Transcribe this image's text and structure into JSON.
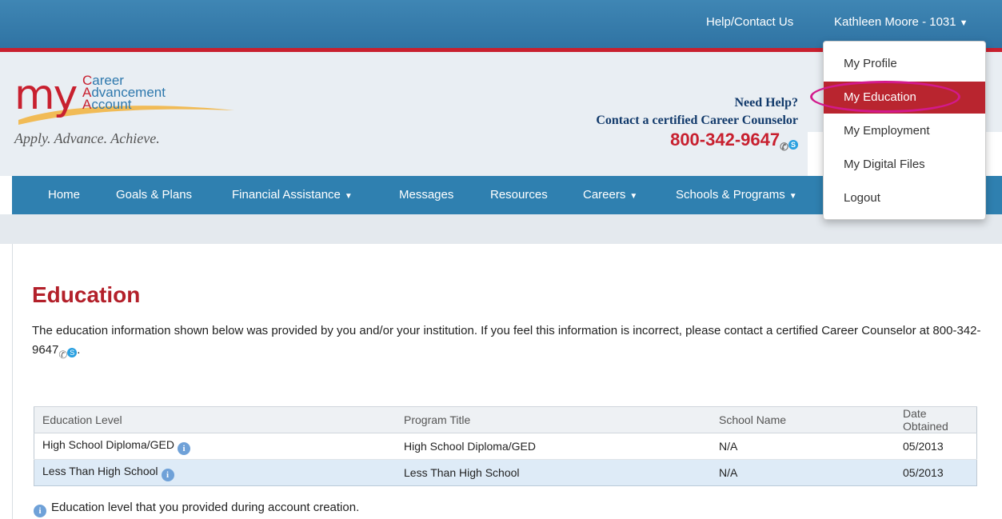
{
  "topbar": {
    "help_label": "Help/Contact Us",
    "user_label": "Kathleen Moore - 1031"
  },
  "logo": {
    "my": "my",
    "line1": "areer",
    "line2": "dvancement",
    "line3": "ccount",
    "c": "C",
    "a1": "A",
    "a2": "A",
    "tagline": "Apply. Advance. Achieve."
  },
  "help": {
    "line1": "Need Help?",
    "line2": "Contact a certified Career Counselor",
    "phone": "800-342-9647"
  },
  "nav": {
    "home": "Home",
    "goals": "Goals & Plans",
    "financial": "Financial Assistance",
    "messages": "Messages",
    "resources": "Resources",
    "careers": "Careers",
    "schools": "Schools & Programs"
  },
  "dropdown": {
    "profile": "My Profile",
    "education": "My Education",
    "employment": "My Employment",
    "digital": "My Digital Files",
    "logout": "Logout"
  },
  "page": {
    "title": "Education",
    "intro": "The education information shown below was provided by you and/or your institution. If you feel this information is incorrect, please contact a certified Career Counselor at 800-342-9647",
    "intro_end": "."
  },
  "table": {
    "headers": [
      "Education Level",
      "Program Title",
      "School Name",
      "Date Obtained"
    ],
    "rows": [
      {
        "level": "High School Diploma/GED",
        "program": "High School Diploma/GED",
        "school": "N/A",
        "date": "05/2013"
      },
      {
        "level": "Less Than High School",
        "program": "Less Than High School",
        "school": "N/A",
        "date": "05/2013"
      }
    ]
  },
  "footnote": "Education level that you provided during account creation.",
  "colors": {
    "brand_red": "#b9252f",
    "brand_blue": "#2f80b0",
    "highlight": "#d21a8c"
  },
  "icons": {
    "info": "info-icon",
    "phone": "phone-icon",
    "skype": "skype-icon",
    "caret": "caret-down-icon"
  }
}
